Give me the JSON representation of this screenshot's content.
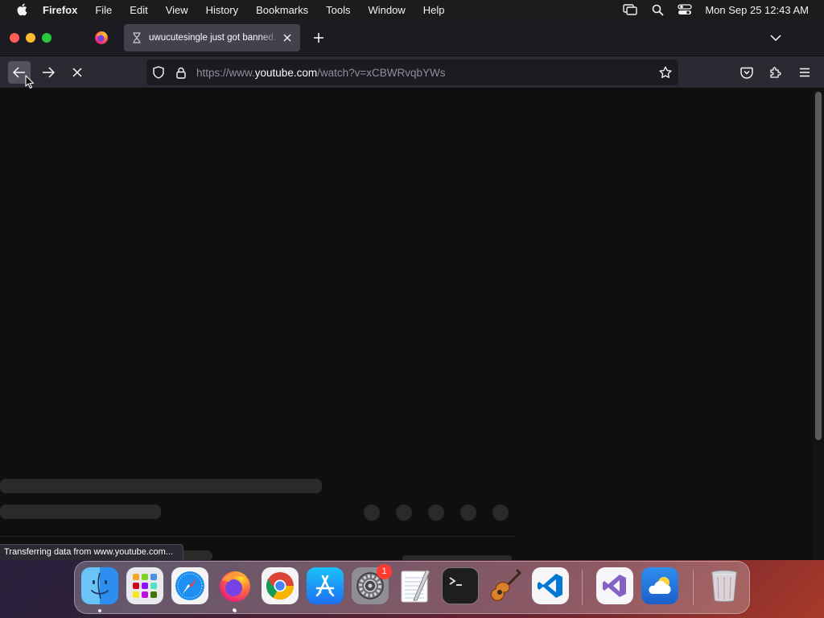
{
  "menubar": {
    "apple_icon": "apple-logo-icon",
    "app_name": "Firefox",
    "items": [
      "File",
      "Edit",
      "View",
      "History",
      "Bookmarks",
      "Tools",
      "Window",
      "Help"
    ],
    "status_icons": [
      "screen-mirroring-icon",
      "spotlight-search-icon",
      "control-center-icon"
    ],
    "clock": "Mon Sep 25  12:43 AM"
  },
  "browser": {
    "pinned_tab_icon": "firefox-icon",
    "tab": {
      "title": "uwucutesingle just got banned...",
      "icon": "hourglass-loading-icon",
      "close_icon": "close-icon"
    },
    "new_tab_icon": "plus-icon",
    "list_all_tabs_icon": "chevron-down-icon",
    "nav": {
      "back_icon": "back-arrow-icon",
      "forward_icon": "forward-arrow-icon",
      "stop_icon": "stop-loading-icon"
    },
    "url": {
      "prefix": "https://www.",
      "domain": "youtube.com",
      "path": "/watch?v=xCBWRvqbYWs"
    },
    "status_text": "Transferring data from www.youtube.com..."
  },
  "dock": {
    "apps": [
      "Finder",
      "Launchpad",
      "Safari",
      "Firefox",
      "Google Chrome",
      "App Store",
      "System Settings",
      "TextEdit",
      "Terminal",
      "GarageBand",
      "Visual Studio Code",
      "Visual Studio",
      "Weather",
      "Trash"
    ],
    "system_settings_badge": "1"
  },
  "colors": {
    "accent": "#0060df",
    "tab_active": "#42414d",
    "toolbar": "#2b2a33",
    "page_bg": "#0f0f0f"
  }
}
